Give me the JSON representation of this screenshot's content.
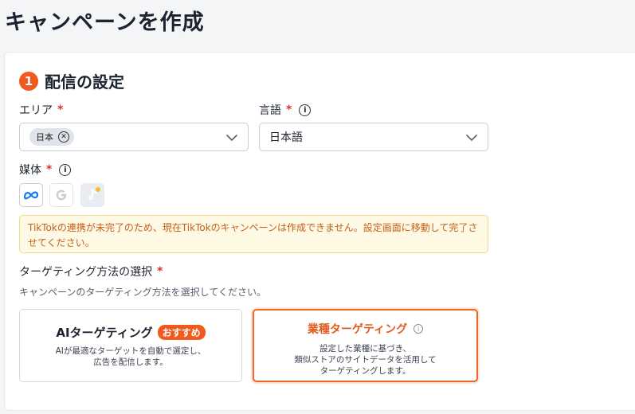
{
  "page": {
    "title": "キャンペーンを作成"
  },
  "section": {
    "step": "1",
    "title": "配信の設定"
  },
  "area": {
    "label": "エリア",
    "required": "*",
    "chip": "日本",
    "chip_remove_icon": "close-circle-icon",
    "dropdown_icon": "chevron-down-icon"
  },
  "language": {
    "label": "言語",
    "required": "*",
    "info_icon": "info-icon",
    "value": "日本語",
    "dropdown_icon": "chevron-down-icon"
  },
  "media": {
    "label": "媒体",
    "required": "*",
    "info_icon": "info-icon",
    "items": [
      {
        "name": "meta",
        "icon": "meta-icon",
        "state": "enabled"
      },
      {
        "name": "google",
        "icon": "google-icon",
        "state": "disabled"
      },
      {
        "name": "tiktok",
        "icon": "tiktok-icon",
        "state": "disabled"
      }
    ]
  },
  "warning": {
    "text": "TikTokの連携が未完了のため、現在TikTokのキャンペーンは作成できません。設定画面に移動して完了させてください。"
  },
  "targeting": {
    "label": "ターゲティング方法の選択",
    "required": "*",
    "helper": "キャンペーンのターゲティング方法を選択してください。",
    "options": [
      {
        "title": "AIターゲティング",
        "badge": "おすすめ",
        "desc": [
          "AIが最適なターゲットを自動で選定し、",
          "広告を配信します。"
        ],
        "selected": false
      },
      {
        "title": "業種ターゲティング",
        "info_icon": "info-icon",
        "desc": [
          "設定した業種に基づき、",
          "類似ストアのサイトデータを活用して",
          "ターゲティングします。"
        ],
        "selected": true
      }
    ]
  },
  "colors": {
    "accent": "#f05a1f",
    "warning_bg": "#fdf9e4",
    "warning_text": "#c85f16",
    "required": "#e0322a"
  }
}
